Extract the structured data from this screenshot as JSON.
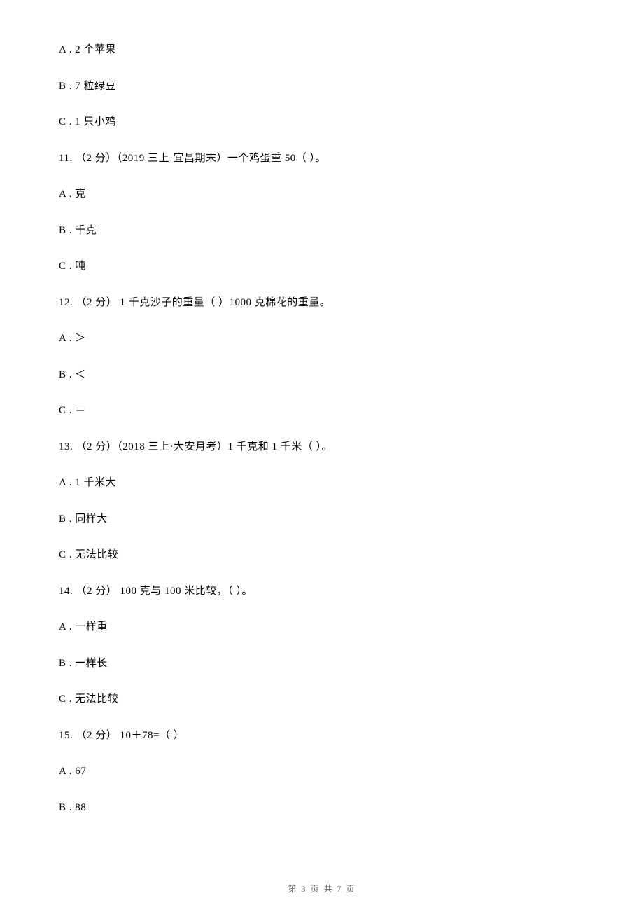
{
  "q10": {
    "optA": "A . 2 个苹果",
    "optB": "B . 7 粒绿豆",
    "optC": "C . 1 只小鸡"
  },
  "q11": {
    "stem": "11. （2 分）（2019 三上·宜昌期末）一个鸡蛋重 50（    ）。",
    "optA": "A . 克",
    "optB": "B . 千克",
    "optC": "C . 吨"
  },
  "q12": {
    "stem": "12. （2 分） 1 千克沙子的重量（    ）1000 克棉花的重量。",
    "optA": "A . ＞",
    "optB": "B . ＜",
    "optC": "C . ＝"
  },
  "q13": {
    "stem": "13. （2 分）（2018 三上·大安月考）1 千克和 1 千米（    ）。",
    "optA": "A . 1 千米大",
    "optB": "B . 同样大",
    "optC": "C . 无法比较"
  },
  "q14": {
    "stem": "14. （2 分） 100 克与 100 米比较，（    ）。",
    "optA": "A . 一样重",
    "optB": "B . 一样长",
    "optC": "C . 无法比较"
  },
  "q15": {
    "stem": "15. （2 分） 10＋78=（    ）",
    "optA": "A . 67",
    "optB": "B . 88"
  },
  "footer": "第 3 页 共 7 页"
}
